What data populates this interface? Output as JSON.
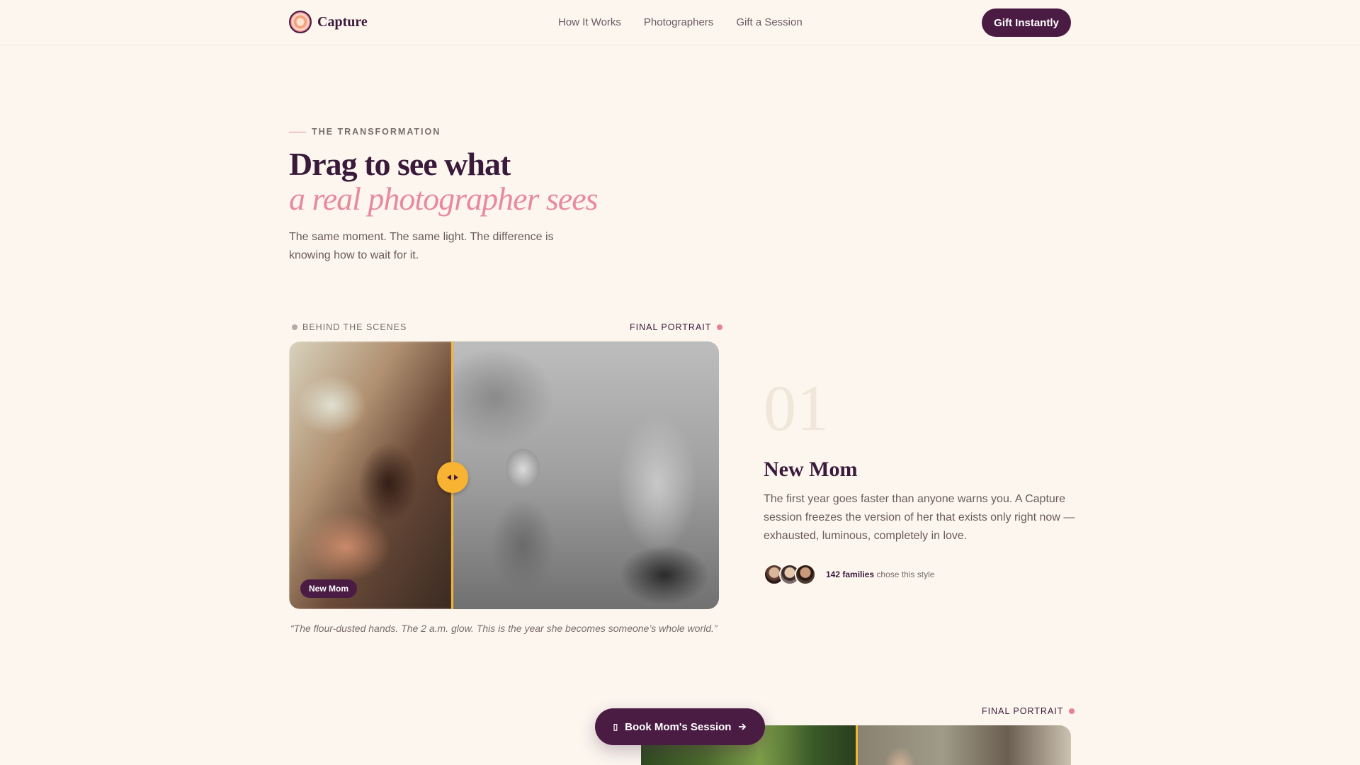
{
  "brand": {
    "name": "Capture"
  },
  "nav": [
    {
      "label": "How It Works"
    },
    {
      "label": "Photographers"
    },
    {
      "label": "Gift a Session"
    }
  ],
  "header_cta": "Gift Instantly",
  "intro": {
    "eyebrow": "THE TRANSFORMATION",
    "headline": "Drag to see what",
    "headline_em": "a real photographer sees",
    "lede": "The same moment. The same light. The difference is knowing how to wait for it."
  },
  "story": {
    "label_before": "BEHIND THE SCENES",
    "label_after": "FINAL PORTRAIT",
    "tag": "New Mom",
    "quote": "“The flour-dusted hands. The 2 a.m. glow. This is the year she becomes someone’s whole world.”",
    "number": "01",
    "title": "New Mom",
    "body": "The first year goes faster than anyone warns you. A Capture session freezes the version of her that exists only right now — exhausted, luminous, completely in love.",
    "families_count": "142 families",
    "families_suffix": "chose this style"
  },
  "story2": {
    "label_after": "FINAL PORTRAIT"
  },
  "floating_cta": "Book Mom's Session",
  "colors": {
    "accent": "#4a1c44",
    "pink": "#e88a9c",
    "handle": "#f7b331",
    "background": "#fcf6ef"
  }
}
